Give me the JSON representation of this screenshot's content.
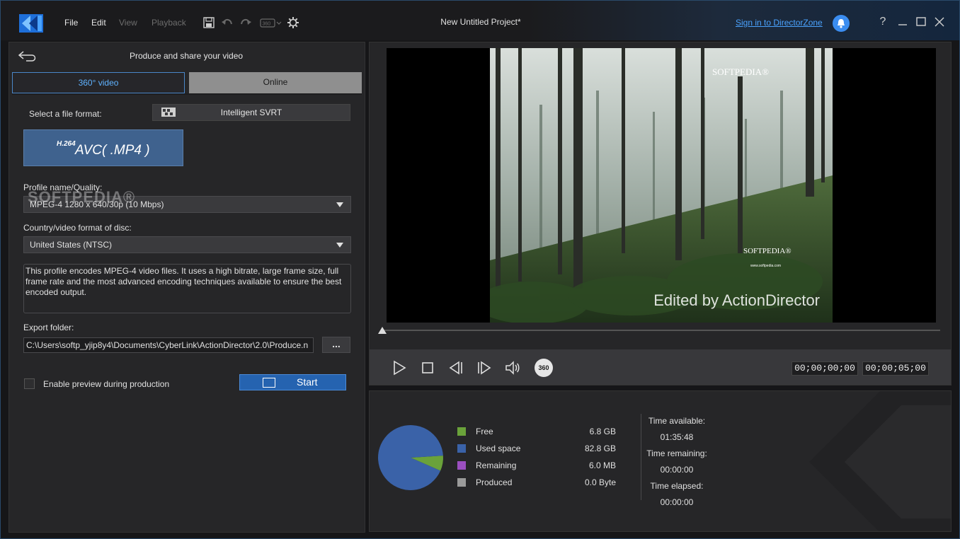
{
  "window": {
    "project_title": "New Untitled Project*",
    "sign_in": "Sign in to DirectorZone"
  },
  "menu": {
    "file": "File",
    "edit": "Edit",
    "view": "View",
    "playback": "Playback"
  },
  "left_panel": {
    "title": "Produce and share your video",
    "tabs": [
      {
        "label": "360° video",
        "active": true
      },
      {
        "label": "Online",
        "active": false
      }
    ],
    "file_format_label": "Select a file format:",
    "svrt_button": "Intelligent SVRT",
    "format_tile": {
      "prefix": "H.264",
      "name": "AVC( .MP4 )"
    },
    "profile_label": "Profile name/Quality:",
    "profile_value": "MPEG-4 1280 x 640/30p (10 Mbps)",
    "country_label": "Country/video format of disc:",
    "country_value": "United States (NTSC)",
    "description": "This profile encodes MPEG-4 video files. It uses a high bitrate, large frame size, full frame rate and the most advanced encoding techniques available to ensure the best encoded output.",
    "export_label": "Export folder:",
    "export_path": "C:\\Users\\softp_yjip8y4\\Documents\\CyberLink\\ActionDirector\\2.0\\Produce.n",
    "browse_label": "...",
    "preview_checkbox_label": "Enable preview during production",
    "preview_checked": false,
    "start_label": "Start",
    "watermark": "SOFTPEDIA®"
  },
  "preview": {
    "watermark_top": "SOFTPEDIA®",
    "watermark_center": "SOFTPEDIA®",
    "watermark_url": "www.softpedia.com",
    "edited_by": "Edited by ActionDirector",
    "seek_position": 0,
    "timecode_current": "00;00;00;00",
    "timecode_total": "00;00;05;00",
    "vr_label": "360"
  },
  "storage": {
    "legend": [
      {
        "label": "Free",
        "value": "6.8  GB",
        "color": "#6aa23a"
      },
      {
        "label": "Used space",
        "value": "82.8  GB",
        "color": "#3a62a8"
      },
      {
        "label": "Remaining",
        "value": "6.0  MB",
        "color": "#9b4fc0"
      },
      {
        "label": "Produced",
        "value": "0.0  Byte",
        "color": "#9a9a9a"
      }
    ],
    "time_available_label": "Time available:",
    "time_available": "01:35:48",
    "time_remaining_label": "Time remaining:",
    "time_remaining": "00:00:00",
    "time_elapsed_label": "Time elapsed:",
    "time_elapsed": "00:00:00"
  },
  "colors": {
    "accent": "#4aa3ff",
    "start_button": "#2563b0",
    "format_tile": "#3f628e"
  }
}
